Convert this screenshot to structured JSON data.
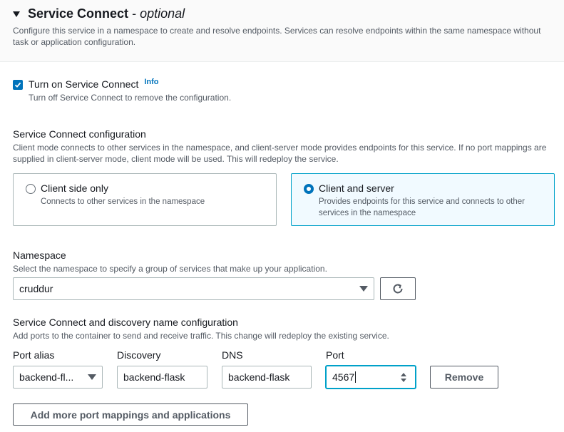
{
  "section": {
    "title": "Service Connect",
    "separator": "-",
    "optional": "optional",
    "description": "Configure this service in a namespace to create and resolve endpoints. Services can resolve endpoints within the same namespace without task or application configuration."
  },
  "toggle": {
    "label": "Turn on Service Connect",
    "info": "Info",
    "checked": true,
    "description": "Turn off Service Connect to remove the configuration."
  },
  "config": {
    "label": "Service Connect configuration",
    "description": "Client mode connects to other services in the namespace, and client-server mode provides endpoints for this service. If no port mappings are supplied in client-server mode, client mode will be used. This will redeploy the service.",
    "options": [
      {
        "title": "Client side only",
        "description": "Connects to other services in the namespace",
        "selected": false
      },
      {
        "title": "Client and server",
        "description": "Provides endpoints for this service and connects to other services in the namespace",
        "selected": true
      }
    ]
  },
  "namespace": {
    "label": "Namespace",
    "description": "Select the namespace to specify a group of services that make up your application.",
    "value": "cruddur",
    "refresh_icon": "refresh-icon"
  },
  "discovery": {
    "label": "Service Connect and discovery name configuration",
    "description": "Add ports to the container to send and receive traffic. This change will redeploy the existing service.",
    "columns": {
      "port_alias": "Port alias",
      "discovery": "Discovery",
      "dns": "DNS",
      "port": "Port"
    },
    "row": {
      "port_alias": "backend-fl...",
      "discovery": "backend-flask",
      "dns": "backend-flask",
      "port": "4567"
    },
    "remove_label": "Remove",
    "add_label": "Add more port mappings and applications"
  },
  "colors": {
    "accent": "#0073bb",
    "selected_border": "#00a1c9",
    "selected_bg": "#f1faff"
  }
}
